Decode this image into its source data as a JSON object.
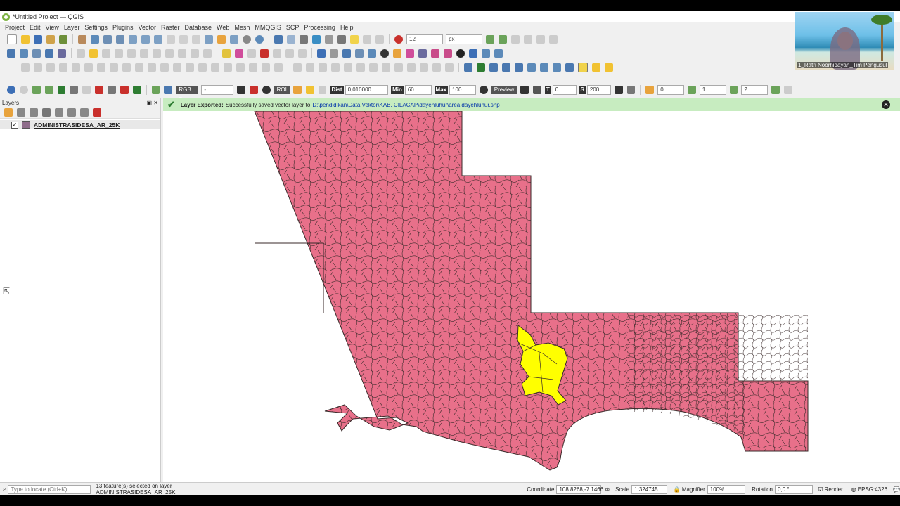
{
  "window": {
    "title": "*Untitled Project — QGIS"
  },
  "menu": [
    "Project",
    "Edit",
    "View",
    "Layer",
    "Settings",
    "Plugins",
    "Vector",
    "Raster",
    "Database",
    "Web",
    "Mesh",
    "MMQGIS",
    "SCP",
    "Processing",
    "Help"
  ],
  "toolbar": {
    "font_size": "12",
    "unit": "px"
  },
  "scp": {
    "rgb": "RGB =",
    "rgb_value": "-",
    "roi": "ROI",
    "dist_label": "Dist",
    "dist": "0,010000",
    "min_label": "Min",
    "min": "60",
    "max_label": "Max",
    "max": "100",
    "preview": "Preview",
    "t_label": "T",
    "t": "0",
    "s_label": "S",
    "s": "200",
    "v0": "0",
    "v1": "1",
    "v2": "2"
  },
  "layers_panel": {
    "title": "Layers",
    "layer_name": "ADMINISTRASIDESA_AR_25K"
  },
  "message": {
    "title": "Layer Exported:",
    "text": "Successfully saved vector layer to",
    "path": "D:\\pendidikan\\Data Vektor\\KAB. CILACAP\\dayehluhur\\area dayehluhur.shp"
  },
  "status": {
    "locate_placeholder": "Type to locate (Ctrl+K)",
    "selected": "13 feature(s) selected on layer ADMINISTRASIDESA_AR_25K.",
    "coordinate_label": "Coordinate",
    "coordinate": "108.8268,-7.1466",
    "scale_label": "Scale",
    "scale": "1:324745",
    "magnifier_label": "Magnifier",
    "magnifier": "100%",
    "rotation_label": "Rotation",
    "rotation": "0,0 °",
    "render_label": "Render",
    "crs": "EPSG:4326"
  },
  "webcam": {
    "name": "1_Ratri Noorhidayah_Tim Pengusul"
  },
  "colors": {
    "polygon_fill": "#e8708a",
    "selected_fill": "#ffff00",
    "boundary": "#3a2a2a",
    "message_bg": "#c7ecc0"
  }
}
